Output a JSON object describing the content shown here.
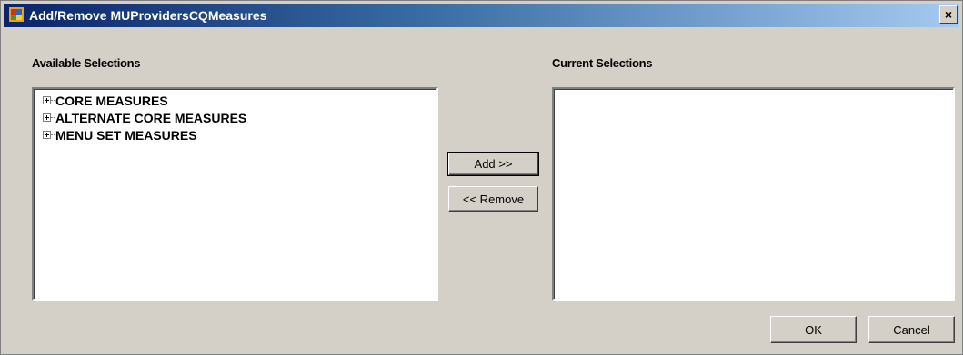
{
  "window": {
    "title": "Add/Remove MUProvidersCQMeasures",
    "close_glyph": "×"
  },
  "available": {
    "label": "Available Selections",
    "items": [
      {
        "label": "CORE MEASURES",
        "icon": "plus-expander-icon"
      },
      {
        "label": "ALTERNATE CORE MEASURES",
        "icon": "plus-expander-icon"
      },
      {
        "label": "MENU SET MEASURES",
        "icon": "plus-expander-icon"
      }
    ]
  },
  "current": {
    "label": "Current Selections",
    "items": []
  },
  "buttons": {
    "add": "Add >>",
    "remove": "<< Remove",
    "ok": "OK",
    "cancel": "Cancel"
  },
  "colors": {
    "titlebar_start": "#0a246a",
    "titlebar_end": "#a6caf0",
    "dialog_face": "#d4d0c8",
    "list_background": "#ffffff"
  }
}
